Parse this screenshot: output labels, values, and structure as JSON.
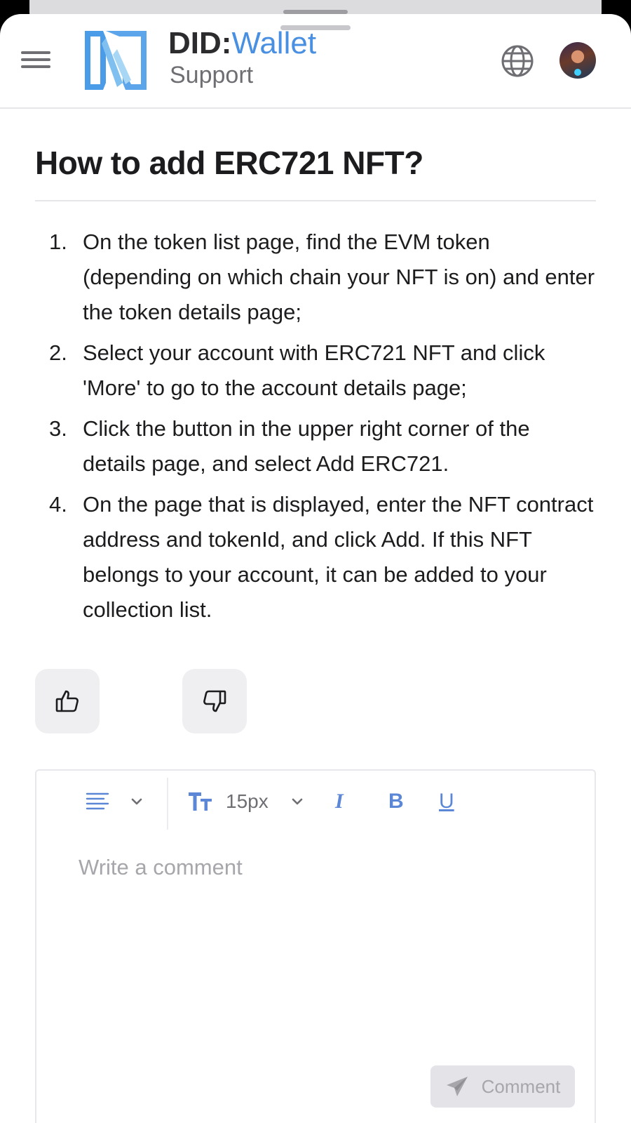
{
  "header": {
    "brand_main": "DID",
    "brand_colon": ":",
    "brand_accent": "Wallet",
    "brand_sub": "Support",
    "accent_color": "#4a90e2"
  },
  "article": {
    "title": "How to add ERC721 NFT?",
    "steps": [
      {
        "num": "1.",
        "text": "On the token list page, find the EVM token (depending on which chain your NFT is on) and enter the token details page;"
      },
      {
        "num": "2.",
        "text": "Select your account with ERC721 NFT and click 'More' to go to the account details page;"
      },
      {
        "num": "3.",
        "text": "Click the button in the upper right corner of the details page, and select Add ERC721."
      },
      {
        "num": "4.",
        "text": "On the page that is displayed, enter the NFT contract address and tokenId, and click Add. If this NFT belongs to your account, it can be added to your collection list."
      }
    ]
  },
  "feedback": {
    "up_icon": "thumbs-up-icon",
    "down_icon": "thumbs-down-icon"
  },
  "editor": {
    "font_size": "15px",
    "italic_label": "I",
    "bold_label": "B",
    "underline_label": "U",
    "placeholder": "Write a comment",
    "submit_label": "Comment"
  }
}
